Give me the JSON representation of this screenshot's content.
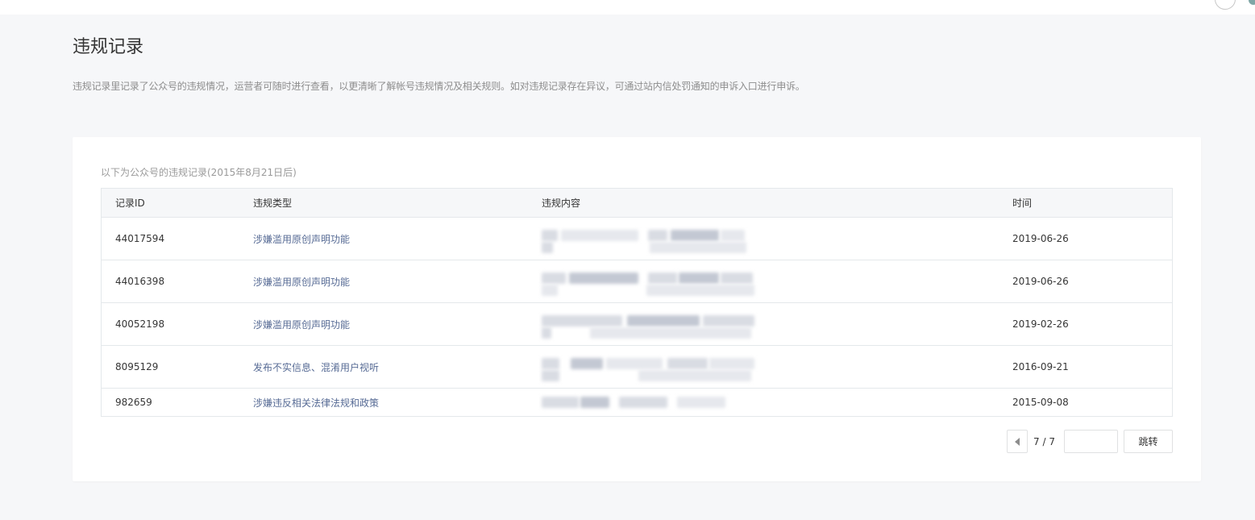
{
  "page": {
    "title": "违规记录",
    "description": "违规记录里记录了公众号的违规情况，运营者可随时进行查看，以更清晰了解帐号违规情况及相关规则。如对违规记录存在异议，可通过站内信处罚通知的申诉入口进行申诉。"
  },
  "card": {
    "caption": "以下为公众号的违规记录(2015年8月21日后)"
  },
  "table": {
    "headers": [
      "记录ID",
      "违规类型",
      "违规内容",
      "时间"
    ],
    "rows": [
      {
        "id": "44017594",
        "type": "涉嫌滥用原创声明功能",
        "date": "2019-06-26"
      },
      {
        "id": "44016398",
        "type": "涉嫌滥用原创声明功能",
        "date": "2019-06-26"
      },
      {
        "id": "40052198",
        "type": "涉嫌滥用原创声明功能",
        "date": "2019-02-26"
      },
      {
        "id": "8095129",
        "type": "发布不实信息、混淆用户视听",
        "date": "2016-09-21"
      },
      {
        "id": "982659",
        "type": "涉嫌违反相关法律法规和政策",
        "date": "2015-09-08"
      }
    ]
  },
  "pagination": {
    "page_text": "7 / 7",
    "jump_input_value": "",
    "jump_label": "跳转"
  },
  "icons": {
    "prev": "chevron-left-icon"
  },
  "colors": {
    "background": "#f6f7f9",
    "link": "#576b95",
    "border": "#e4e8eb"
  }
}
